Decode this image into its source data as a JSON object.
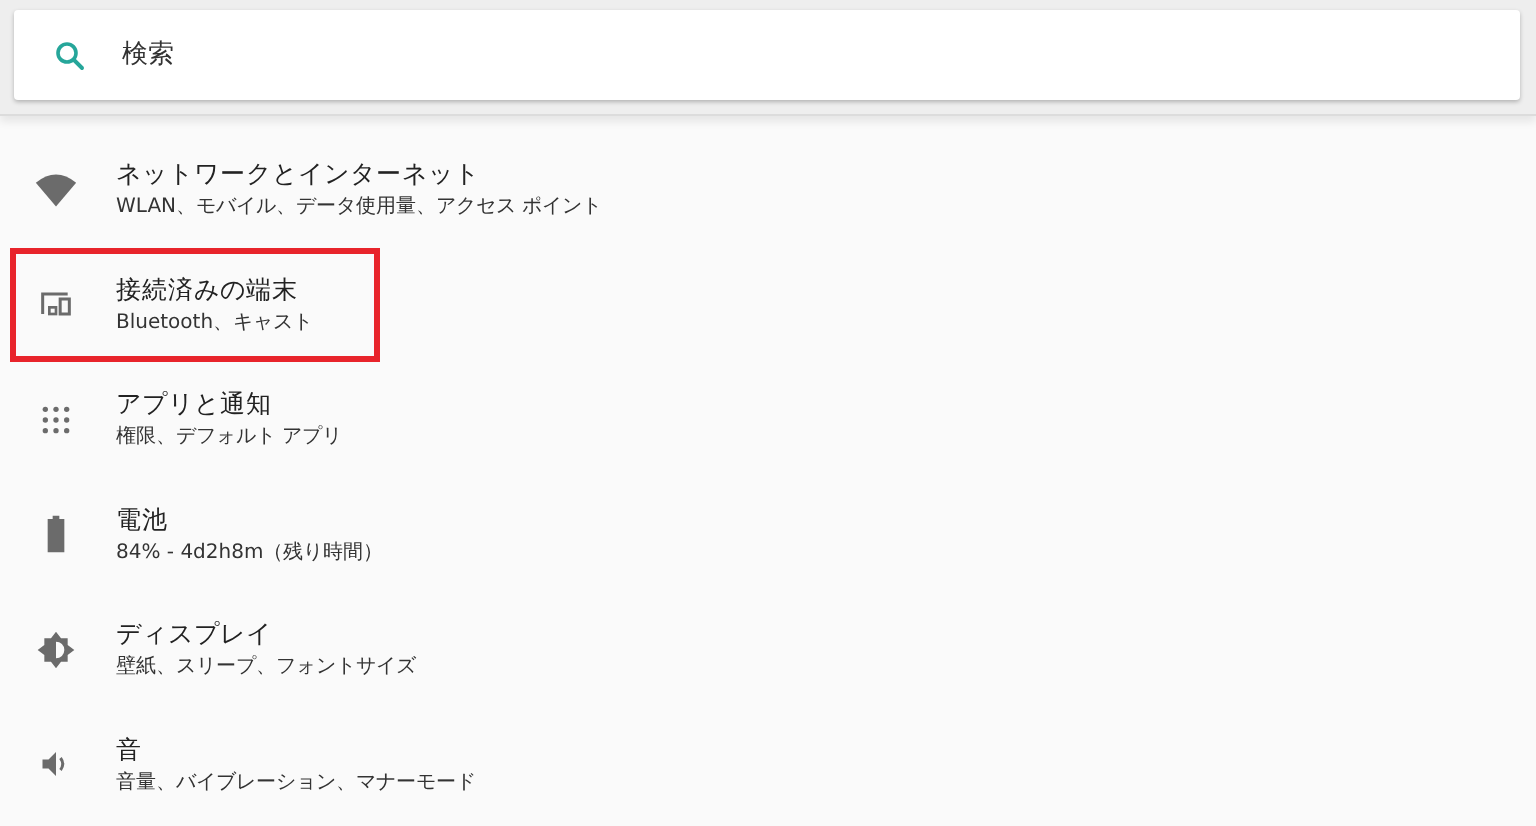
{
  "search": {
    "placeholder": "検索"
  },
  "items": [
    {
      "kind": "wifi",
      "title": "ネットワークとインターネット",
      "subtitle": "WLAN、モバイル、データ使用量、アクセス ポイント",
      "highlighted": false
    },
    {
      "kind": "devices",
      "title": "接続済みの端末",
      "subtitle": "Bluetooth、キャスト",
      "highlighted": true
    },
    {
      "kind": "apps",
      "title": "アプリと通知",
      "subtitle": "権限、デフォルト アプリ",
      "highlighted": false
    },
    {
      "kind": "battery",
      "title": "電池",
      "subtitle": "84% - 4d2h8m（残り時間）",
      "highlighted": false
    },
    {
      "kind": "display",
      "title": "ディスプレイ",
      "subtitle": "壁紙、スリープ、フォントサイズ",
      "highlighted": false
    },
    {
      "kind": "sound",
      "title": "音",
      "subtitle": "音量、バイブレーション、マナーモード",
      "highlighted": false
    }
  ]
}
